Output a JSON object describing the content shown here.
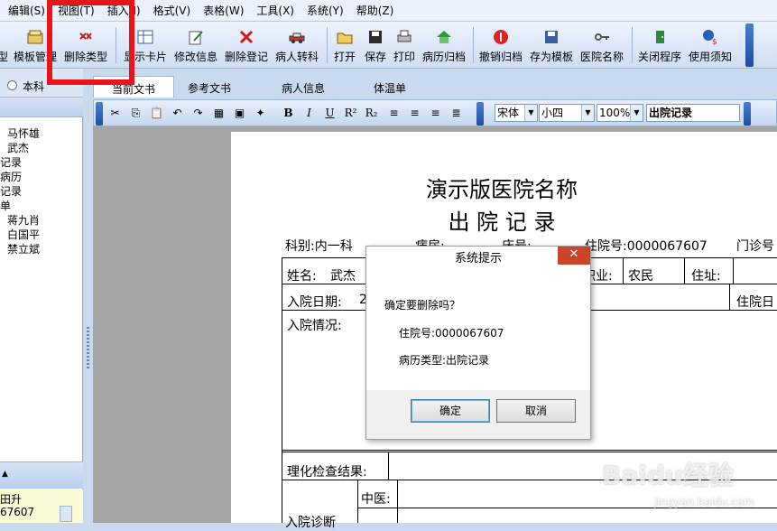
{
  "menubar": {
    "items": [
      "编辑(S)",
      "视图(T)",
      "插入(I)",
      "格式(V)",
      "表格(W)",
      "工具(X)",
      "系统(Y)",
      "帮助(Z)"
    ]
  },
  "toolbar": {
    "type_label": "型",
    "template_mgmt_label": "模板管理",
    "delete_type_label": "删除类型",
    "show_card_label": "显示卡片",
    "modify_info_label": "修改信息",
    "delete_record_label": "删除登记",
    "transfer_label": "病人转科",
    "open_label": "打开",
    "save_label": "保存",
    "print_label": "打印",
    "archive_label": "病历归档",
    "unarchive_label": "撤销归档",
    "save_template_label": "存为模板",
    "hospital_name_label": "医院名称",
    "close_label": "关闭程序",
    "notice_label": "使用须知"
  },
  "left_panel": {
    "radio_label": "本科",
    "tree_items": [
      "马怀雄",
      "武杰",
      "记录",
      "病历",
      "记录",
      "单",
      "蒋九肖",
      "白国平",
      "禁立斌"
    ],
    "lower_items": [
      "田升",
      "67607"
    ]
  },
  "doc_tabs": [
    "当前文书",
    "参考文书",
    "病人信息",
    "体温单"
  ],
  "format_bar": {
    "font": "宋体",
    "size": "小四",
    "zoom": "100%",
    "doc_name": "出院记录"
  },
  "document": {
    "hospital_name": "演示版医院名称",
    "doc_title": "出 院 记 录",
    "dept": "科别:内一科",
    "ward": "病房:",
    "bed": "床号:",
    "inpatient_no": "住院号:0000067607",
    "outpatient_no": "门诊号",
    "name_label": "姓名:",
    "name_value": "武杰",
    "occupation_label": "职业:",
    "occupation_value": "农民",
    "address_label": "住址:",
    "admit_date_label": "入院日期:",
    "admit_date_value": "2",
    "discharge_date_label": "住院日",
    "admit_status_label": "入院情况:",
    "lab_results_label": "理化检查结果:",
    "tcm_label": "中医:",
    "admit_diag_label": "入院诊断"
  },
  "dialog": {
    "title": "系统提示",
    "close_glyph": "✕",
    "message": "确定要删除吗？",
    "inpatient_line": "住院号:0000067607",
    "type_line": "病历类型:出院记录",
    "ok_label": "确定",
    "cancel_label": "取消"
  },
  "watermark": {
    "logo": "Baidu经验",
    "url": "jingyan.baidu.com"
  },
  "colors": {
    "highlight": "#e8141a",
    "chrome": "#c9d9ee",
    "dialog_close": "#c8452c"
  }
}
